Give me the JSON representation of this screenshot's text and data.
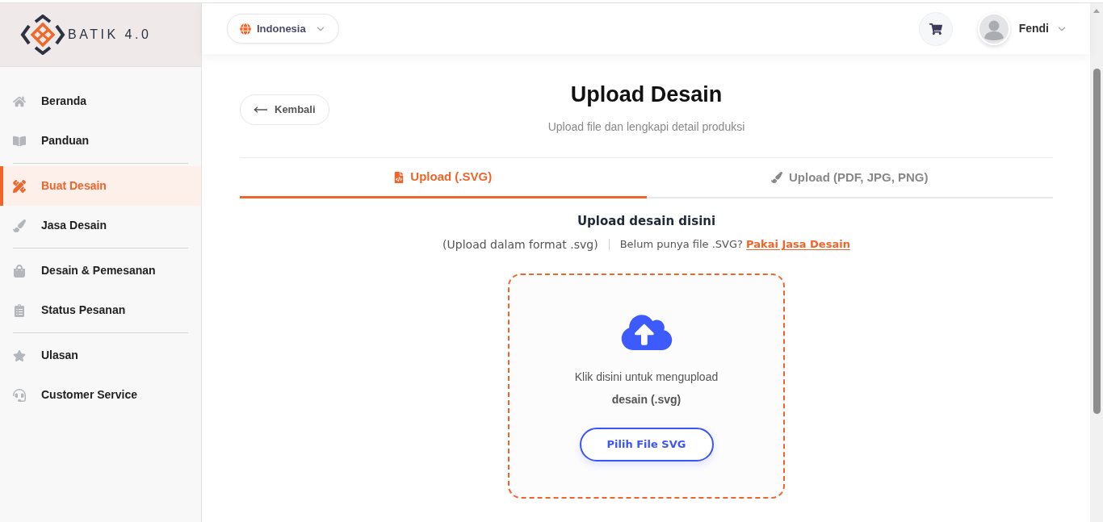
{
  "logo": {
    "text": "BATIK 4.0"
  },
  "sidebar": {
    "sections": [
      {
        "items": [
          {
            "label": "Beranda",
            "selected": false
          },
          {
            "label": "Panduan",
            "selected": false
          }
        ]
      },
      {
        "items": [
          {
            "label": "Buat Desain",
            "selected": true
          },
          {
            "label": "Jasa Desain",
            "selected": false
          }
        ]
      },
      {
        "items": [
          {
            "label": "Desain & Pemesanan",
            "selected": false
          },
          {
            "label": "Status Pesanan",
            "selected": false
          }
        ]
      },
      {
        "items": [
          {
            "label": "Ulasan",
            "selected": false
          },
          {
            "label": "Customer Service",
            "selected": false
          }
        ]
      }
    ]
  },
  "header": {
    "language": "Indonesia",
    "user": "Fendi"
  },
  "page": {
    "back": "Kembali",
    "title": "Upload Desain",
    "subtitle": "Upload file dan lengkapi detail produksi"
  },
  "tabs": [
    {
      "label": "Upload (.SVG)",
      "selected": true
    },
    {
      "label": "Upload (PDF, JPG, PNG)",
      "selected": false
    }
  ],
  "upload": {
    "heading": "Upload desain disini",
    "format_note": "(Upload dalam format .svg)",
    "prompt": "Belum punya file .SVG?",
    "link": "Pakai Jasa Desain",
    "dropzone_text": "Klik disini untuk mengupload",
    "dropzone_subtext": "desain (.svg)",
    "button": "Pilih File SVG"
  }
}
